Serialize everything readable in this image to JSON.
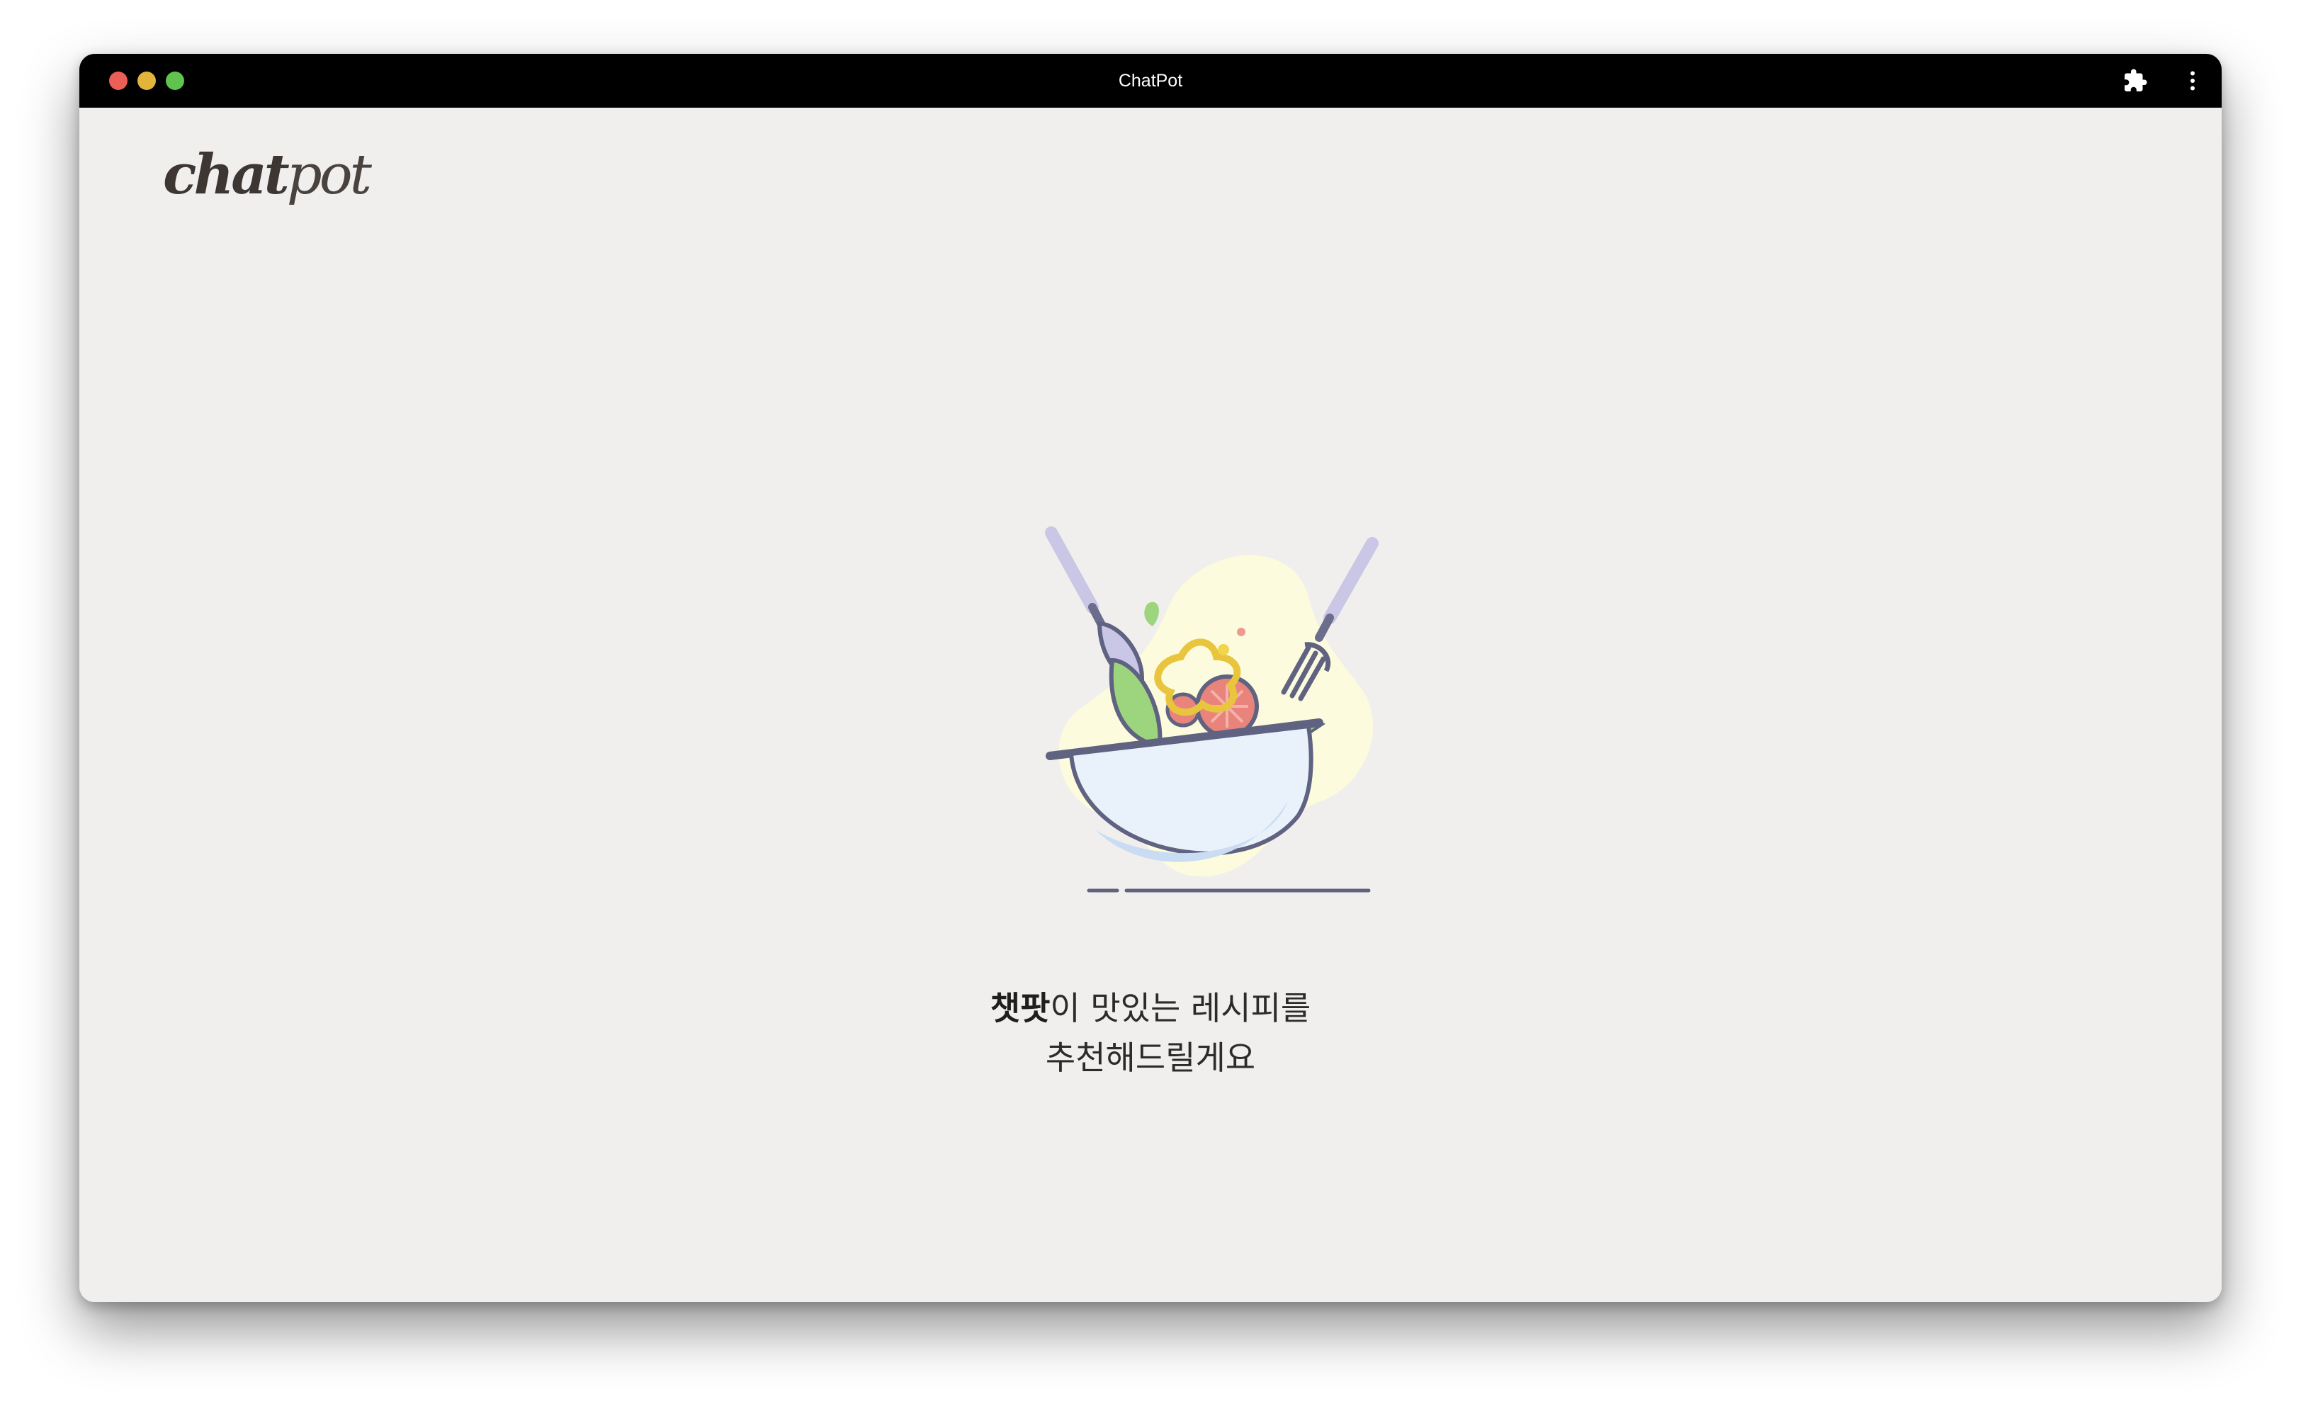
{
  "window": {
    "title": "ChatPot"
  },
  "titlebar": {
    "buttons": [
      "close",
      "minimize",
      "maximize"
    ],
    "icons": [
      "puzzle-icon",
      "more-vertical-icon"
    ]
  },
  "logo": {
    "part1": "chat",
    "part2": "pot"
  },
  "illustration": {
    "icon": "salad-bowl-icon"
  },
  "message": {
    "brand": "챗팟",
    "line1_rest": "이 맛있는 레시피를",
    "line2": "추천해드릴게요"
  },
  "colors": {
    "background": "#f0efed",
    "titlebar": "#000000",
    "text": "#2b2b2b",
    "logo": "#3d3633"
  }
}
